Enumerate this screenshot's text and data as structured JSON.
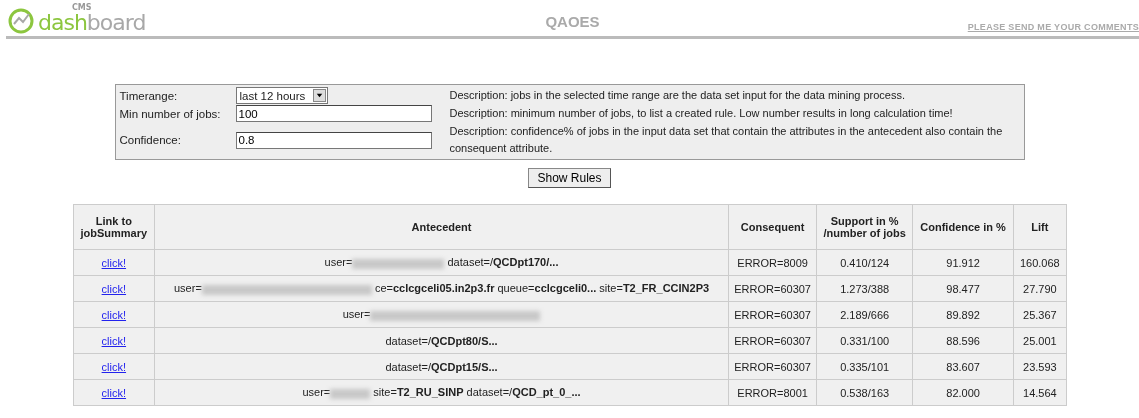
{
  "header": {
    "logo": {
      "small": "CMS",
      "green": "dash",
      "grey": "board"
    },
    "title": "QAOES",
    "comments_link": "PLEASE SEND ME YOUR COMMENTS"
  },
  "form": {
    "rows": [
      {
        "kind": "select",
        "label": "Timerange:",
        "value": "last 12 hours",
        "description": "Description: jobs in the selected time range are the data set input for the data mining process."
      },
      {
        "kind": "input",
        "label": "Min number of jobs:",
        "value": "100",
        "description": "Description: minimum number of jobs, to list a created rule. Low number results in long calculation time!"
      },
      {
        "kind": "input",
        "label": "Confidence:",
        "value": "0.8",
        "description": "Description: confidence% of jobs in the input data set that contain the attributes in the antecedent also contain the consequent attribute."
      }
    ],
    "button": "Show Rules"
  },
  "table": {
    "columns": [
      "Link to jobSummary",
      "Antecedent",
      "Consequent",
      "Support in % /number of jobs",
      "Confidence in %",
      "Lift"
    ],
    "rows": [
      {
        "link": "click!",
        "antecedent": [
          {
            "kind": "text",
            "text": "user="
          },
          {
            "kind": "redacted_medium"
          },
          {
            "kind": "text",
            "text": " dataset=/**QCDpt170/...**"
          }
        ],
        "consequent": "ERROR=8009",
        "support": "0.410/124",
        "confidence": "91.912",
        "lift": "160.068"
      },
      {
        "link": "click!",
        "antecedent": [
          {
            "kind": "text",
            "text": "user="
          },
          {
            "kind": "redacted_long"
          },
          {
            "kind": "text",
            "text": " ce=**cclcgceli05.in2p3.fr** queue=**cclcgceli0...** site=**T2_FR_CCIN2P3**"
          }
        ],
        "consequent": "ERROR=60307",
        "support": "1.273/388",
        "confidence": "98.477",
        "lift": "27.790"
      },
      {
        "link": "click!",
        "antecedent": [
          {
            "kind": "text",
            "text": "user="
          },
          {
            "kind": "redacted_long"
          }
        ],
        "consequent": "ERROR=60307",
        "support": "2.189/666",
        "confidence": "89.892",
        "lift": "25.367"
      },
      {
        "link": "click!",
        "antecedent": [
          {
            "kind": "text",
            "text": "dataset=/**QCDpt80/S...**"
          }
        ],
        "consequent": "ERROR=60307",
        "support": "0.331/100",
        "confidence": "88.596",
        "lift": "25.001"
      },
      {
        "link": "click!",
        "antecedent": [
          {
            "kind": "text",
            "text": "dataset=/**QCDpt15/S...**"
          }
        ],
        "consequent": "ERROR=60307",
        "support": "0.335/101",
        "confidence": "83.607",
        "lift": "23.593"
      },
      {
        "link": "click!",
        "antecedent": [
          {
            "kind": "text",
            "text": "user="
          },
          {
            "kind": "redacted_short"
          },
          {
            "kind": "text",
            "text": " site=**T2_RU_SINP** dataset=/**QCD_pt_0_...**"
          }
        ],
        "consequent": "ERROR=8001",
        "support": "0.538/163",
        "confidence": "82.000",
        "lift": "14.564"
      }
    ]
  }
}
